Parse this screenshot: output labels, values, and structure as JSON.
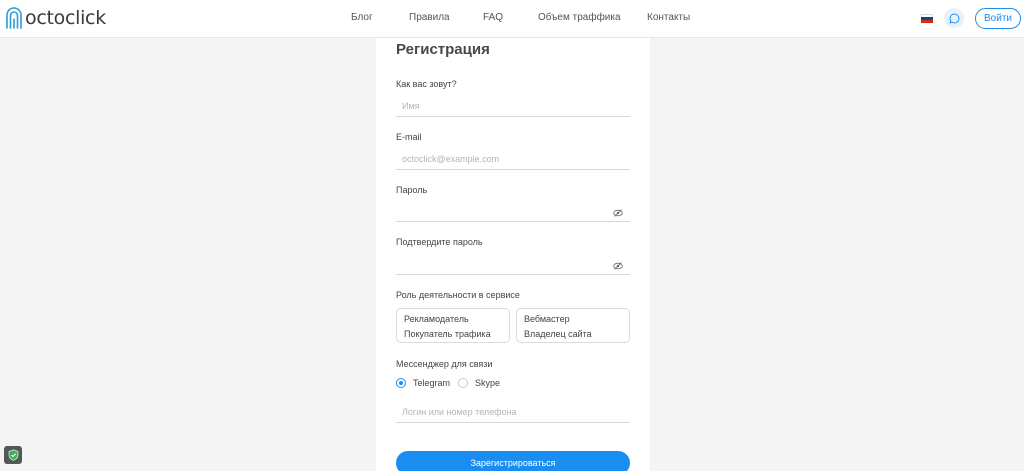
{
  "header": {
    "logo_text": "octoclick",
    "nav": [
      {
        "label": "Блог"
      },
      {
        "label": "Правила"
      },
      {
        "label": "FAQ"
      },
      {
        "label": "Объем траффика"
      },
      {
        "label": "Контакты"
      }
    ],
    "login_label": "Войти",
    "flag_colors": [
      "#ffffff",
      "#1c3f94",
      "#d52b1e"
    ],
    "accent_color": "#1a8ef0"
  },
  "form": {
    "title": "Регистрация",
    "name": {
      "label": "Как вас зовут?",
      "placeholder": "Имя",
      "value": ""
    },
    "email": {
      "label": "E-mail",
      "placeholder": "octoclick@example.com",
      "value": ""
    },
    "password": {
      "label": "Пароль",
      "placeholder": "",
      "value": ""
    },
    "password_confirm": {
      "label": "Подтвердите пароль",
      "placeholder": "",
      "value": ""
    },
    "role": {
      "label": "Роль деятельности в сервисе",
      "options": [
        {
          "line1": "Рекламодатель",
          "line2": "Покупатель трафика"
        },
        {
          "line1": "Вебмастер",
          "line2": "Владелец сайта"
        }
      ]
    },
    "messenger": {
      "label": "Мессенджер для связи",
      "options": [
        {
          "label": "Telegram",
          "checked": true
        },
        {
          "label": "Skype",
          "checked": false
        }
      ],
      "contact": {
        "placeholder": "Логин или номер телефона",
        "value": ""
      }
    },
    "submit_label": "Зарегистрироваться"
  },
  "icons": {
    "logo": "octopus-logo-icon",
    "chat": "chat-bubble-icon",
    "password_toggle": "eye-off-icon",
    "security": "shield-icon"
  }
}
